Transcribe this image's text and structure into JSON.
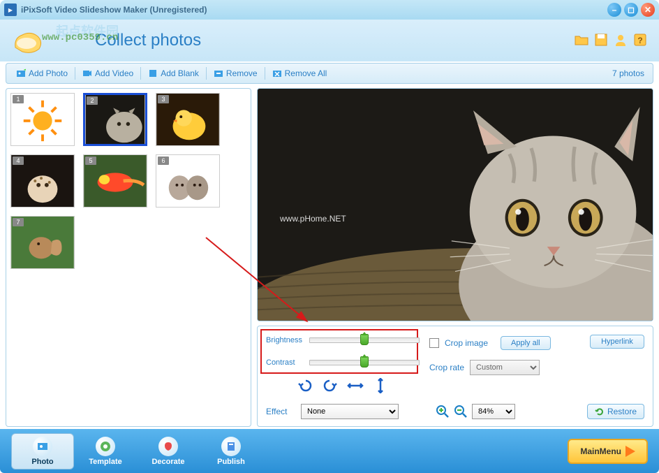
{
  "window": {
    "title": "iPixSoft Video Slideshow Maker (Unregistered)"
  },
  "overlay": {
    "url": "www.pc0359.cn",
    "cn_text": "起点软件园"
  },
  "page": {
    "title": "Collect photos"
  },
  "toolbar": {
    "add_photo": "Add Photo",
    "add_video": "Add Video",
    "add_blank": "Add Blank",
    "remove": "Remove",
    "remove_all": "Remove All",
    "photo_count": "7 photos"
  },
  "thumbs": [
    {
      "num": "1",
      "desc": "sun drawing"
    },
    {
      "num": "2",
      "desc": "cat",
      "selected": true
    },
    {
      "num": "3",
      "desc": "duckling"
    },
    {
      "num": "4",
      "desc": "leopard cub"
    },
    {
      "num": "5",
      "desc": "colorful bird"
    },
    {
      "num": "6",
      "desc": "two kittens"
    },
    {
      "num": "7",
      "desc": "squirrel"
    }
  ],
  "preview": {
    "watermark": "www.pHome.NET"
  },
  "controls": {
    "brightness_label": "Brightness",
    "brightness_value": 50,
    "contrast_label": "Contrast",
    "contrast_value": 50,
    "effect_label": "Effect",
    "effect_value": "None",
    "crop_image_label": "Crop image",
    "crop_image_checked": false,
    "apply_all_label": "Apply all",
    "crop_rate_label": "Crop rate",
    "crop_rate_value": "Custom",
    "hyperlink_label": "Hyperlink",
    "zoom_value": "84%",
    "restore_label": "Restore"
  },
  "nav": {
    "photo": "Photo",
    "template": "Template",
    "decorate": "Decorate",
    "publish": "Publish",
    "main_menu": "MainMenu"
  }
}
